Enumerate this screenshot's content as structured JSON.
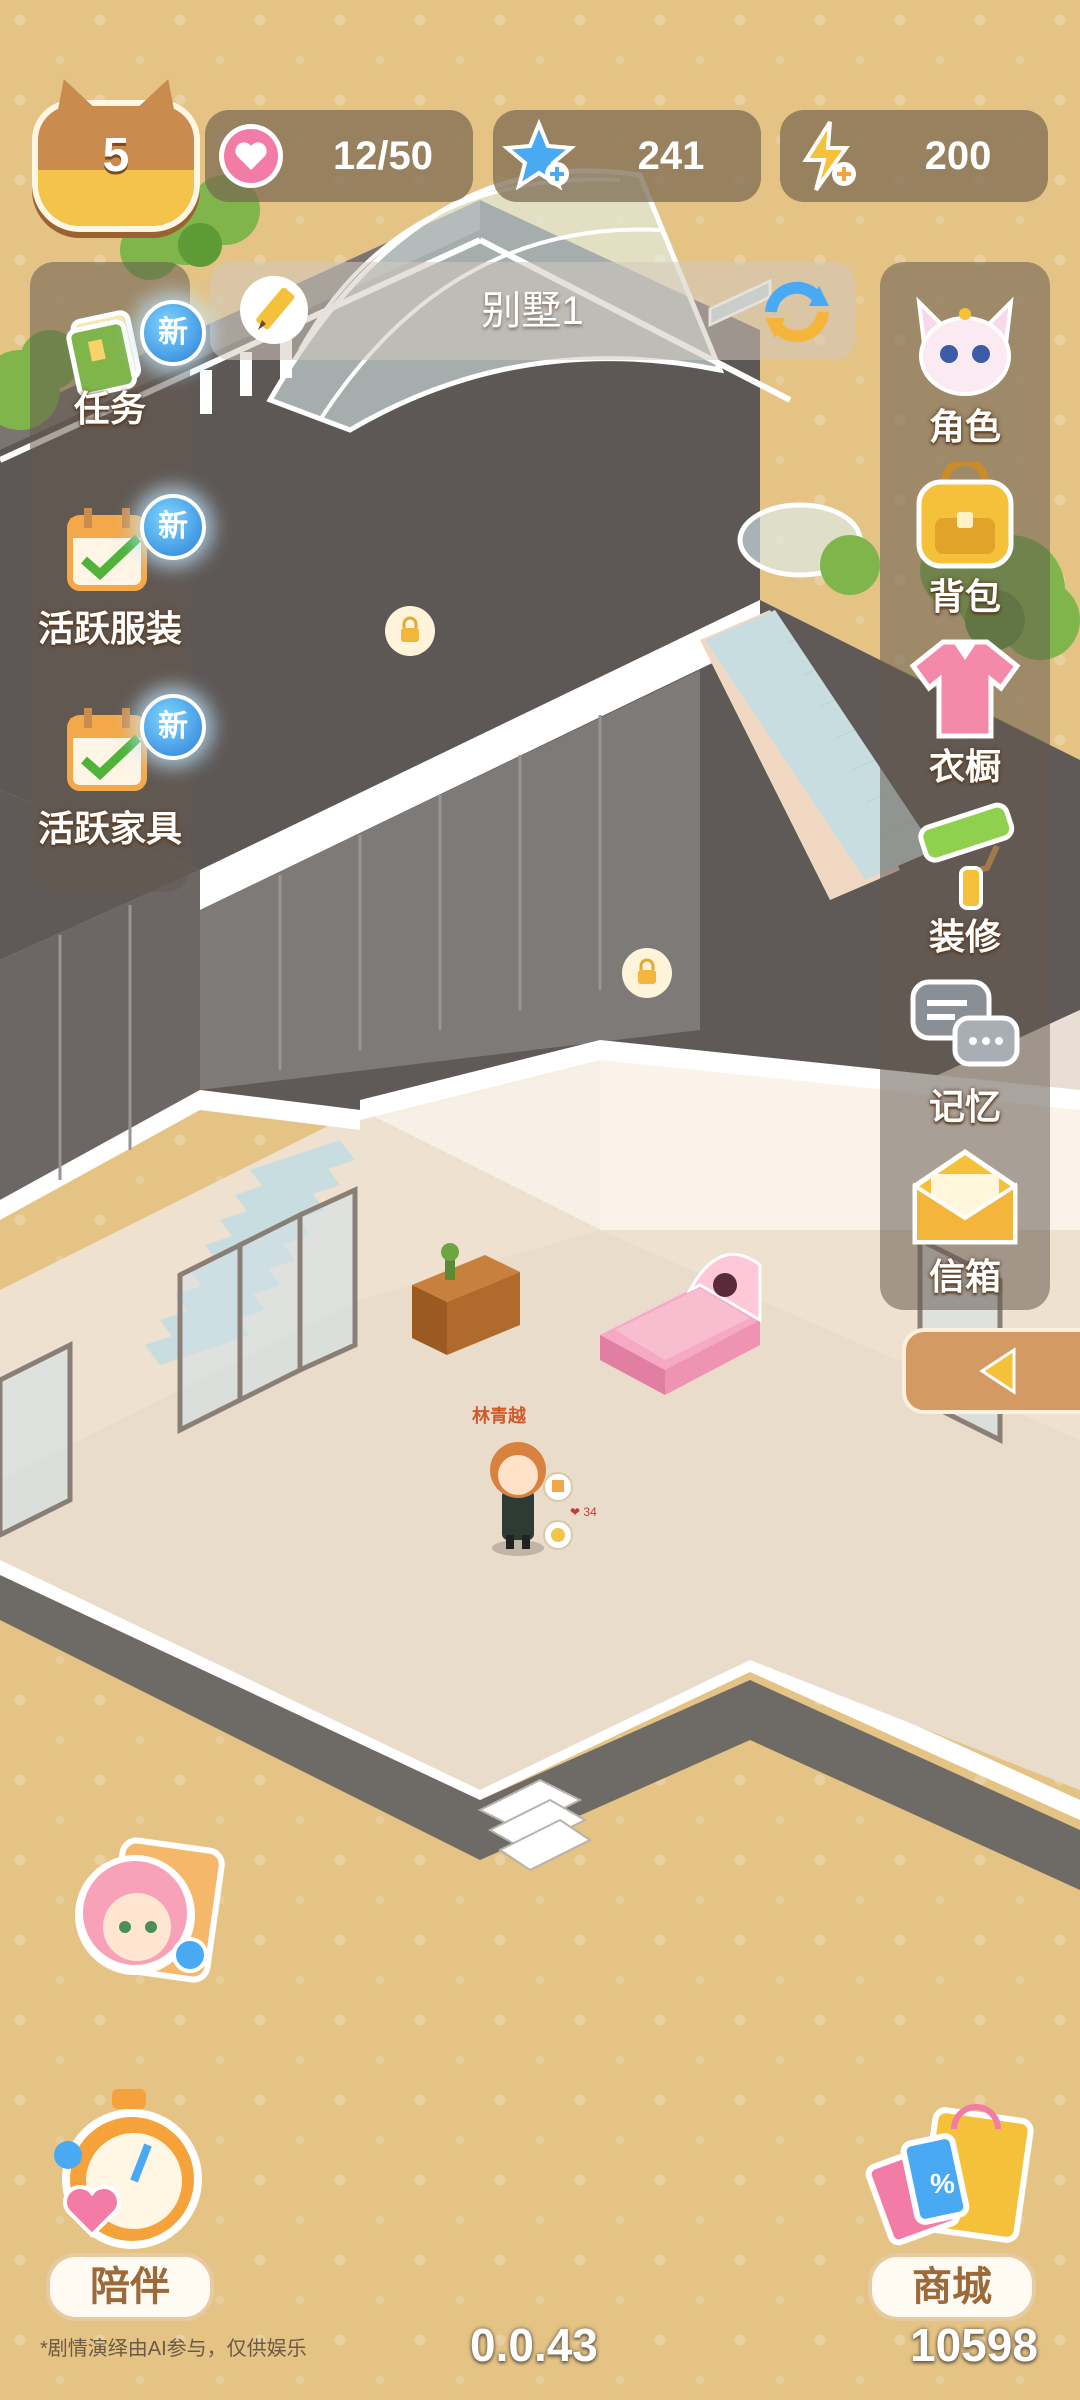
{
  "colors": {
    "background": "#e4c385",
    "panel": "#645a50",
    "accent_orange": "#c98c4e",
    "new_badge": "#2a7fd6"
  },
  "header": {
    "level": "5",
    "hearts": "12/50",
    "diamonds": "241",
    "energy": "200"
  },
  "location": {
    "title": "别墅1"
  },
  "left_menu": [
    {
      "label": "任务",
      "badge": "新",
      "icon": "task-book-icon"
    },
    {
      "label": "活跃服装",
      "badge": "新",
      "icon": "calendar-check-icon"
    },
    {
      "label": "活跃家具",
      "badge": "新",
      "icon": "calendar-check-icon"
    }
  ],
  "right_menu": [
    {
      "label": "角色",
      "icon": "fox-character-icon"
    },
    {
      "label": "背包",
      "icon": "backpack-icon"
    },
    {
      "label": "衣橱",
      "icon": "shirt-icon"
    },
    {
      "label": "装修",
      "icon": "paint-roller-icon"
    },
    {
      "label": "记忆",
      "icon": "chat-bubbles-icon"
    },
    {
      "label": "信箱",
      "icon": "envelope-icon"
    }
  ],
  "scene": {
    "character_name": "林青越",
    "affection_icon": "heart-icon",
    "lock_icon": "lock-icon"
  },
  "bottom": {
    "companion_label": "陪伴",
    "shop_label": "商城",
    "disclaimer": "*剧情演绎由AI参与，仅供娱乐",
    "version": "0.0.43",
    "uid": "10598"
  }
}
